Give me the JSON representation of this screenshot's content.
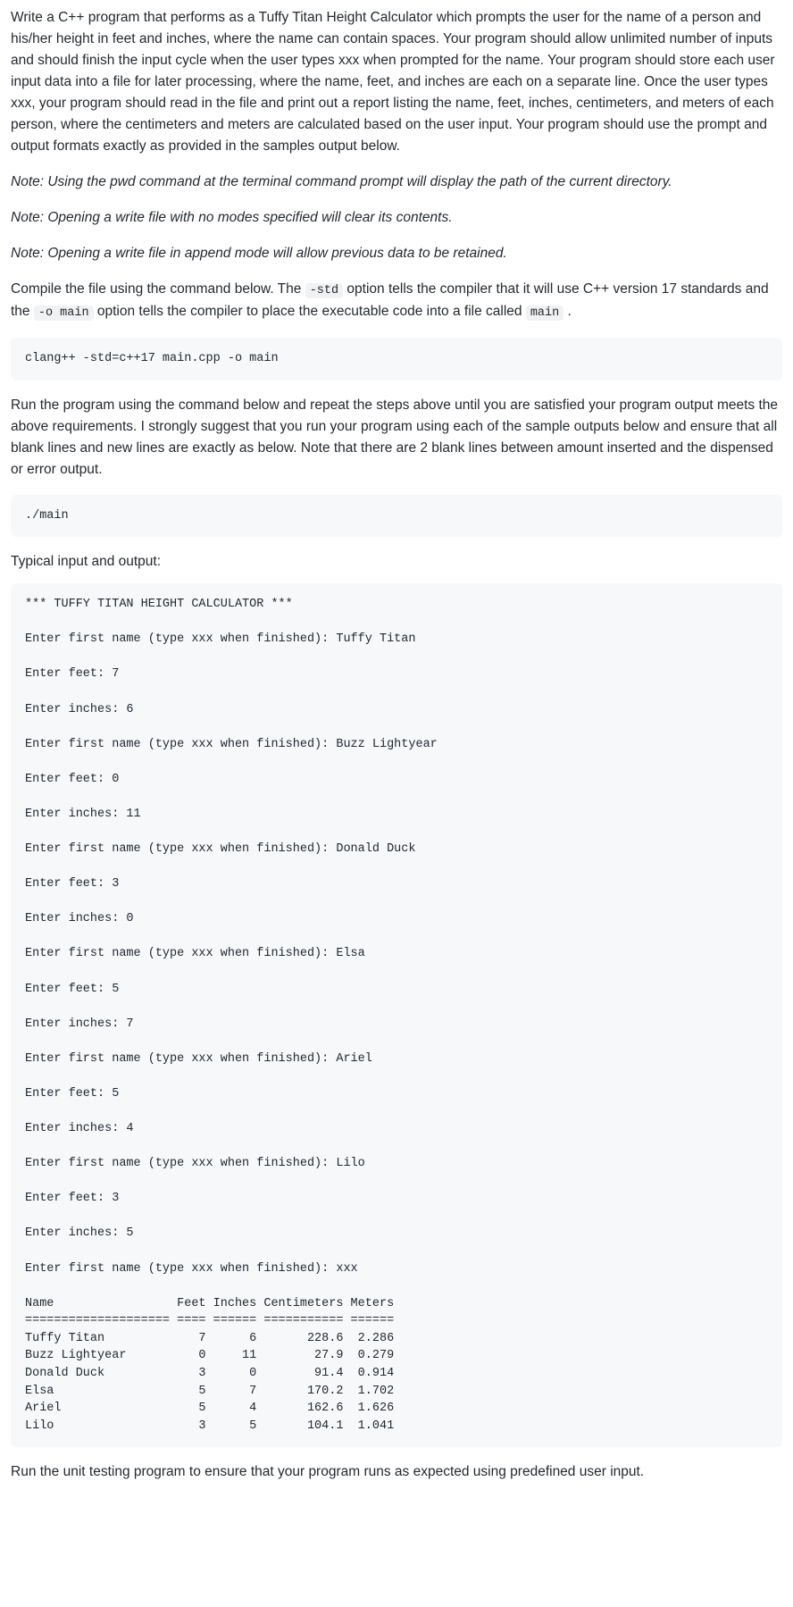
{
  "paragraphs": {
    "intro": "Write a C++ program that performs as a Tuffy Titan Height Calculator which prompts the user for the name of a person and his/her height in feet and inches, where the name can contain spaces. Your program should allow unlimited number of inputs and should finish the input cycle when the user types xxx when prompted for the name. Your program should store each user input data into a file for later processing, where the name, feet, and inches are each on a separate line. Once the user types xxx, your program should read in the file and print out a report listing the name, feet, inches, centimeters, and meters of each person, where the centimeters and meters are calculated based on the user input. Your program should use the prompt and output formats exactly as provided in the samples output below.",
    "note1": "Note: Using the pwd command at the terminal command prompt will display the path of the current directory.",
    "note2": "Note: Opening a write file with no modes specified will clear its contents.",
    "note3": "Note: Opening a write file in append mode will allow previous data to be retained.",
    "compile_pre": "Compile the file using the command below. The ",
    "compile_mid1": " option tells the compiler that it will use C++ version 17 standards and the ",
    "compile_mid2": " option tells the compiler to place the executable code into a file called ",
    "compile_post": " .",
    "std_code": "-std",
    "omain_code": "-o main",
    "main_code": "main",
    "run_para": "Run the program using the command below and repeat the steps above until you are satisfied your program output meets the above requirements. I strongly suggest that you run your program using each of the sample outputs below and ensure that all blank lines and new lines are exactly as below. Note that there are 2 blank lines between amount inserted and the dispensed or error output.",
    "typical_label": "Typical input and output:",
    "unit_test": "Run the unit testing program to ensure that your program runs as expected using predefined user input."
  },
  "codeblocks": {
    "compile": "clang++ -std=c++17 main.cpp -o main",
    "run": "./main",
    "sample": "*** TUFFY TITAN HEIGHT CALCULATOR ***\n\nEnter first name (type xxx when finished): Tuffy Titan\n\nEnter feet: 7\n\nEnter inches: 6\n\nEnter first name (type xxx when finished): Buzz Lightyear\n\nEnter feet: 0\n\nEnter inches: 11\n\nEnter first name (type xxx when finished): Donald Duck\n\nEnter feet: 3\n\nEnter inches: 0\n\nEnter first name (type xxx when finished): Elsa\n\nEnter feet: 5\n\nEnter inches: 7\n\nEnter first name (type xxx when finished): Ariel\n\nEnter feet: 5\n\nEnter inches: 4\n\nEnter first name (type xxx when finished): Lilo\n\nEnter feet: 3\n\nEnter inches: 5\n\nEnter first name (type xxx when finished): xxx\n\nName                 Feet Inches Centimeters Meters\n==================== ==== ====== =========== ======\nTuffy Titan             7      6       228.6  2.286\nBuzz Lightyear          0     11        27.9  0.279\nDonald Duck             3      0        91.4  0.914\nElsa                    5      7       170.2  1.702\nAriel                   5      4       162.6  1.626\nLilo                    3      5       104.1  1.041"
  }
}
